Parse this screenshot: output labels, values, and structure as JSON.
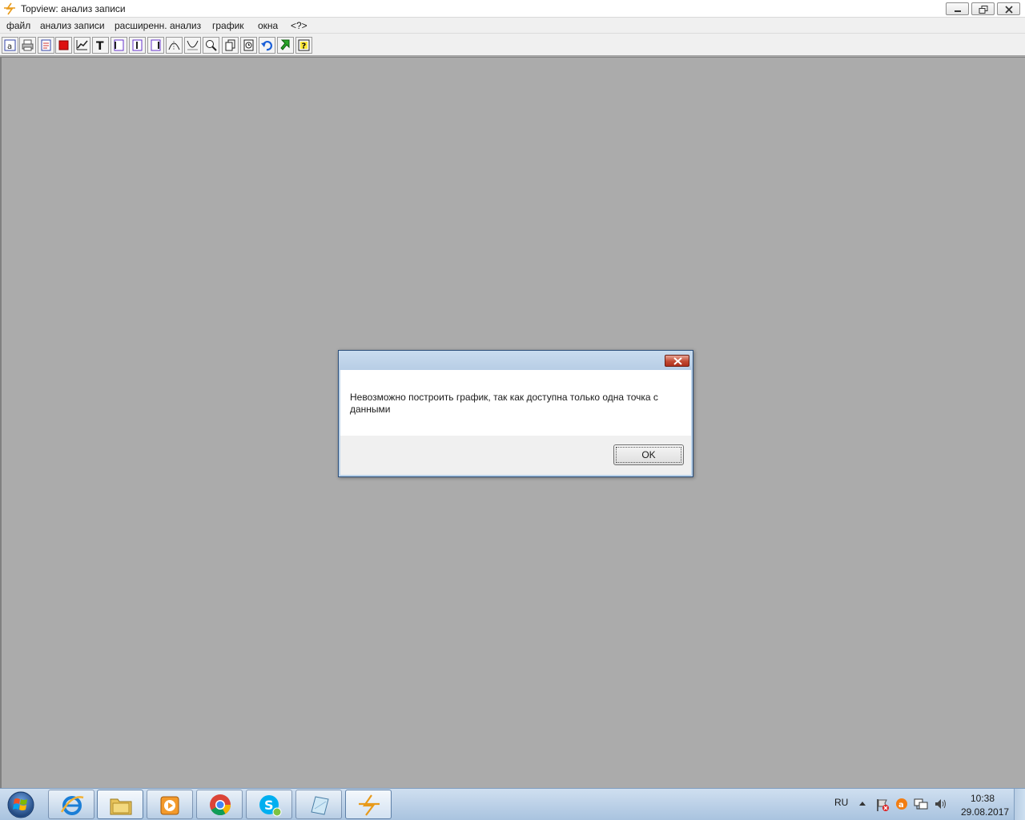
{
  "window": {
    "title": "Topview: анализ записи",
    "controls": [
      "minimize",
      "restore",
      "close"
    ]
  },
  "menu": {
    "items": [
      "файл",
      "анализ записи",
      "расширенн. анализ",
      "график",
      "окна",
      "<?>"
    ]
  },
  "toolbar": {
    "buttons": [
      "text-a-icon",
      "printer-icon",
      "page-icon",
      "stop-icon",
      "chart-line-icon",
      "text-t-icon",
      "document-left-icon",
      "document-center-icon",
      "document-right-icon",
      "curve-up-icon",
      "curve-down-icon",
      "zoom-icon",
      "copy-page-icon",
      "clock-page-icon",
      "undo-icon",
      "green-arrow-icon",
      "help-icon"
    ]
  },
  "dialog": {
    "message": "Невозможно построить график, так как доступна только одна точка с данными",
    "ok_label": "OK"
  },
  "taskbar": {
    "apps": [
      "internet-explorer",
      "file-explorer",
      "media-player",
      "chrome",
      "skype",
      "notepad",
      "topview"
    ],
    "active_app": "topview",
    "language": "RU",
    "time": "10:38",
    "date": "29.08.2017"
  },
  "colors": {
    "workspace": "#ababab",
    "taskbar": "#b9cfe6",
    "dialog_frame": "#bcd3ea",
    "close_red": "#c24a32"
  }
}
